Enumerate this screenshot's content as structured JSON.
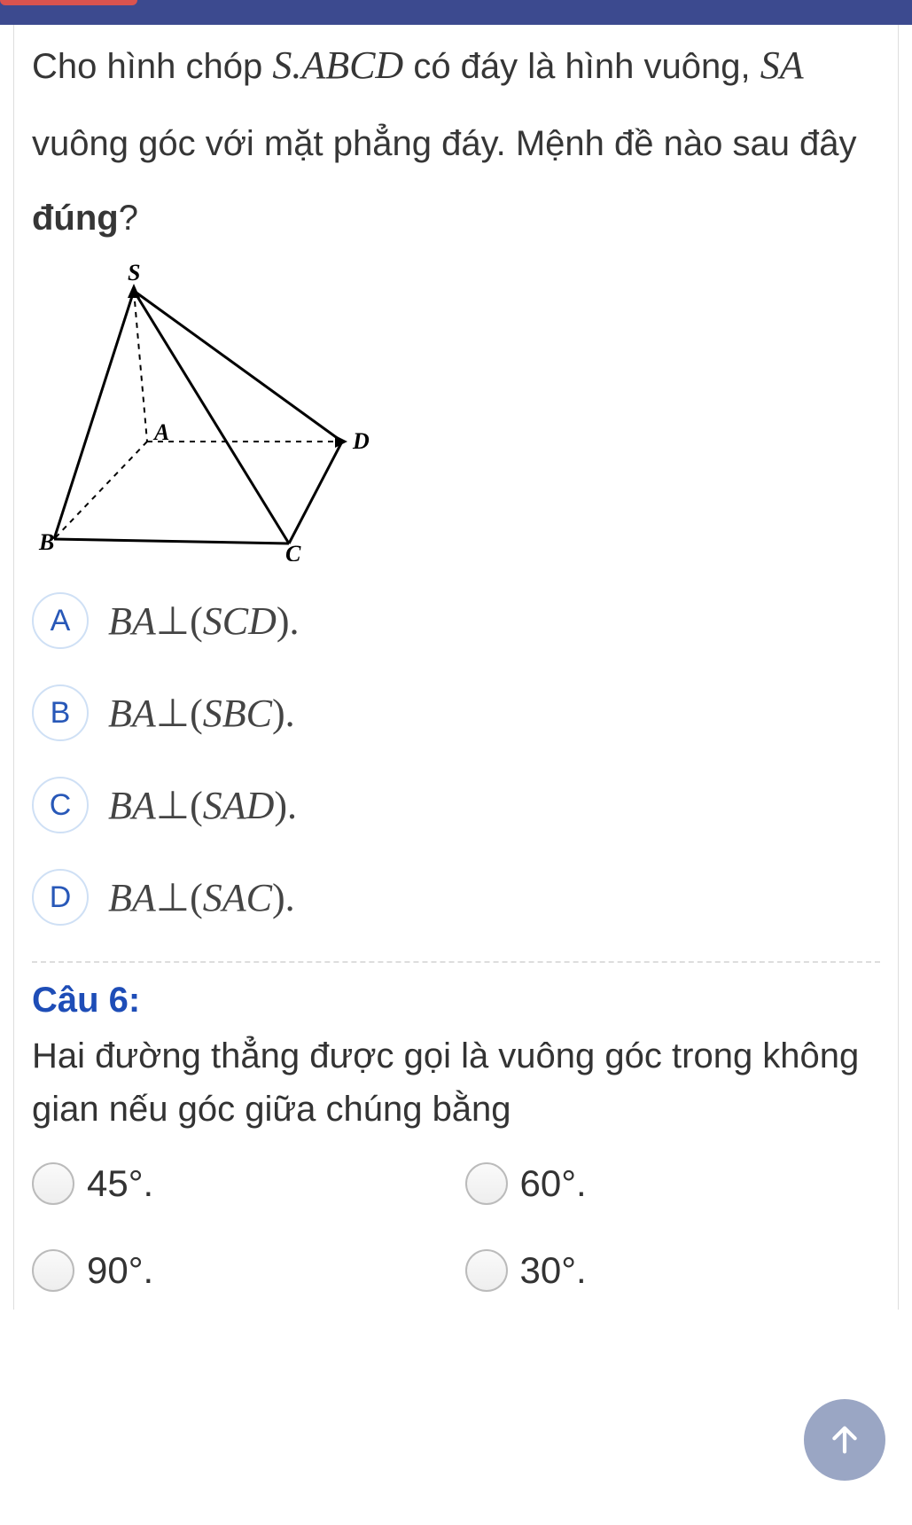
{
  "question5": {
    "text_part1": "Cho hình chóp ",
    "math1": "S.ABCD",
    "text_part2": " có đáy là hình vuông, ",
    "math2": "SA",
    "text_part3": " vuông góc với mặt phẳng đáy. Mệnh đề nào sau đây ",
    "bold": "đúng",
    "text_part4": "?",
    "figure_labels": {
      "S": "S",
      "A": "A",
      "B": "B",
      "C": "C",
      "D": "D"
    },
    "options": [
      {
        "letter": "A",
        "line": "BA",
        "plane": "SCD"
      },
      {
        "letter": "B",
        "line": "BA",
        "plane": "SBC"
      },
      {
        "letter": "C",
        "line": "BA",
        "plane": "SAD"
      },
      {
        "letter": "D",
        "line": "BA",
        "plane": "SAC"
      }
    ]
  },
  "question6": {
    "label": "Câu 6:",
    "text": "Hai đường thẳng được gọi là vuông góc trong không gian nếu góc giữa chúng bằng",
    "options": [
      {
        "value": "45°."
      },
      {
        "value": "60°."
      },
      {
        "value": "90°."
      },
      {
        "value": "30°."
      }
    ]
  }
}
